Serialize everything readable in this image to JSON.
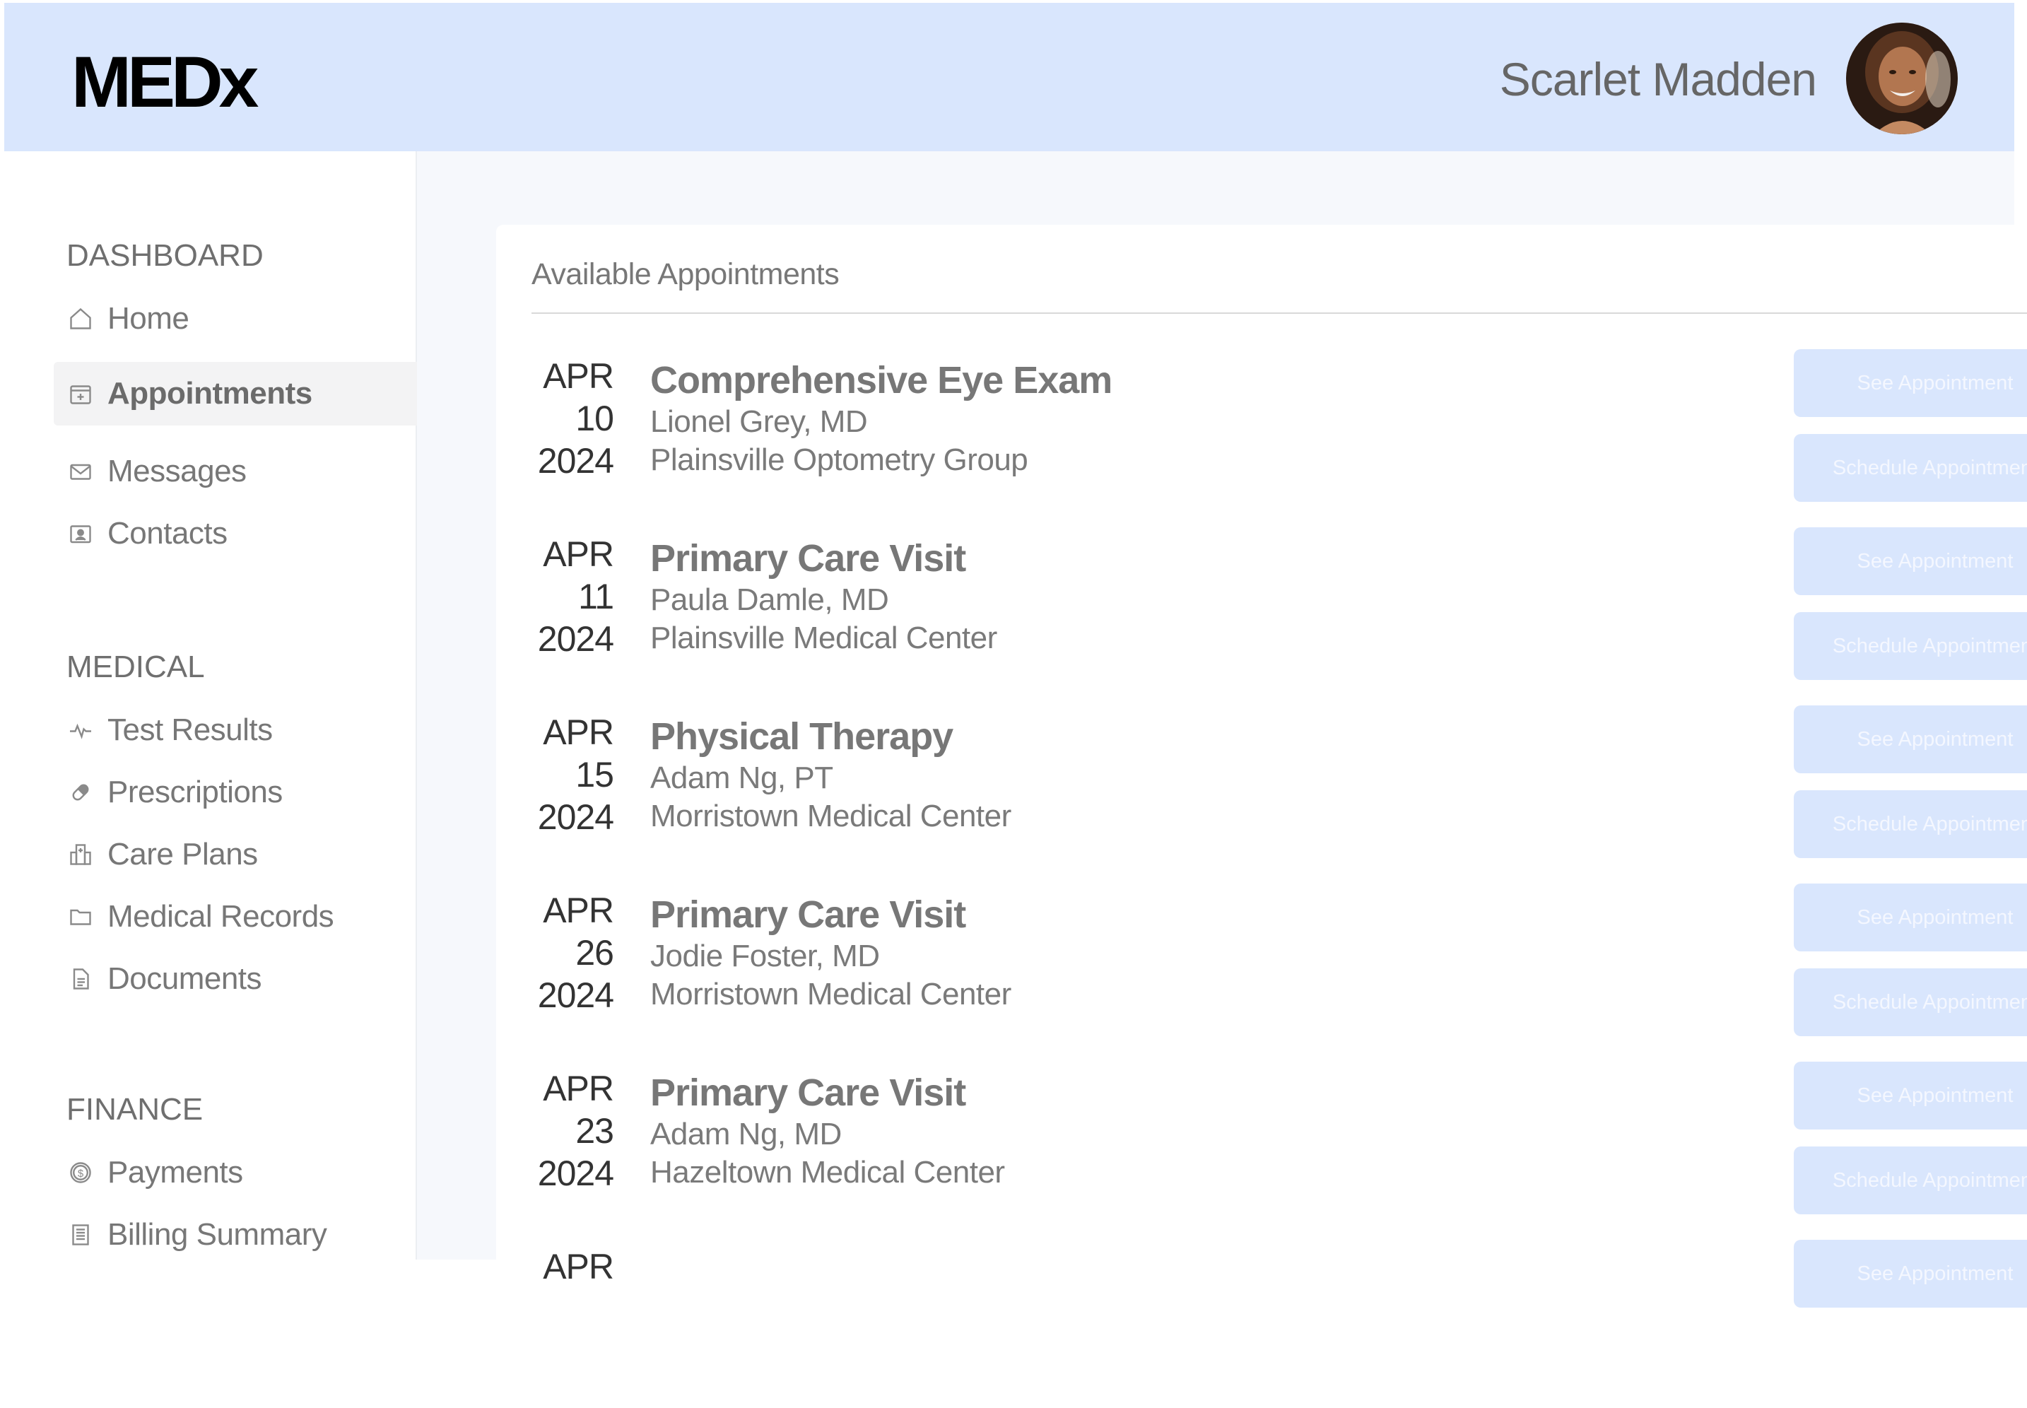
{
  "header": {
    "logo": "MEDx",
    "user_name": "Scarlet Madden",
    "avatar_icon": "user-avatar-photo"
  },
  "colors": {
    "header_bg": "#d9e6fd",
    "button_bg": "#d9e6fd",
    "main_bg": "#f6f8fc"
  },
  "sidebar": {
    "sections": [
      {
        "title": "DASHBOARD",
        "items": [
          {
            "label": "Home",
            "icon": "home-icon"
          },
          {
            "label": "Appointments",
            "icon": "calendar-icon",
            "active": true
          },
          {
            "label": "Messages",
            "icon": "envelope-icon"
          },
          {
            "label": "Contacts",
            "icon": "contact-card-icon"
          }
        ]
      },
      {
        "title": "MEDICAL",
        "items": [
          {
            "label": "Test Results",
            "icon": "pulse-icon"
          },
          {
            "label": "Prescriptions",
            "icon": "pill-icon"
          },
          {
            "label": "Care Plans",
            "icon": "building-icon"
          },
          {
            "label": "Medical Records",
            "icon": "folder-icon"
          },
          {
            "label": "Documents",
            "icon": "document-icon"
          }
        ]
      },
      {
        "title": "FINANCE",
        "items": [
          {
            "label": "Payments",
            "icon": "dollar-coin-icon"
          },
          {
            "label": "Billing Summary",
            "icon": "receipt-icon"
          }
        ]
      }
    ]
  },
  "main": {
    "card_title": "Available Appointments",
    "see_label": "See Appointment",
    "schedule_label": "Schedule Appointment",
    "appointments": [
      {
        "month": "APR",
        "day": "10",
        "year": "2024",
        "title": "Comprehensive Eye Exam",
        "doctor": "Lionel Grey, MD",
        "location": "Plainsville Optometry Group"
      },
      {
        "month": "APR",
        "day": "11",
        "year": "2024",
        "title": "Primary Care Visit",
        "doctor": "Paula Damle, MD",
        "location": "Plainsville Medical Center"
      },
      {
        "month": "APR",
        "day": "15",
        "year": "2024",
        "title": "Physical Therapy",
        "doctor": "Adam Ng, PT",
        "location": "Morristown Medical Center"
      },
      {
        "month": "APR",
        "day": "26",
        "year": "2024",
        "title": "Primary Care Visit",
        "doctor": "Jodie Foster, MD",
        "location": "Morristown Medical Center"
      },
      {
        "month": "APR",
        "day": "23",
        "year": "2024",
        "title": "Primary Care Visit",
        "doctor": "Adam Ng, MD",
        "location": "Hazeltown Medical Center"
      },
      {
        "month": "APR",
        "day": "",
        "year": "",
        "title": "",
        "doctor": "",
        "location": ""
      }
    ]
  }
}
